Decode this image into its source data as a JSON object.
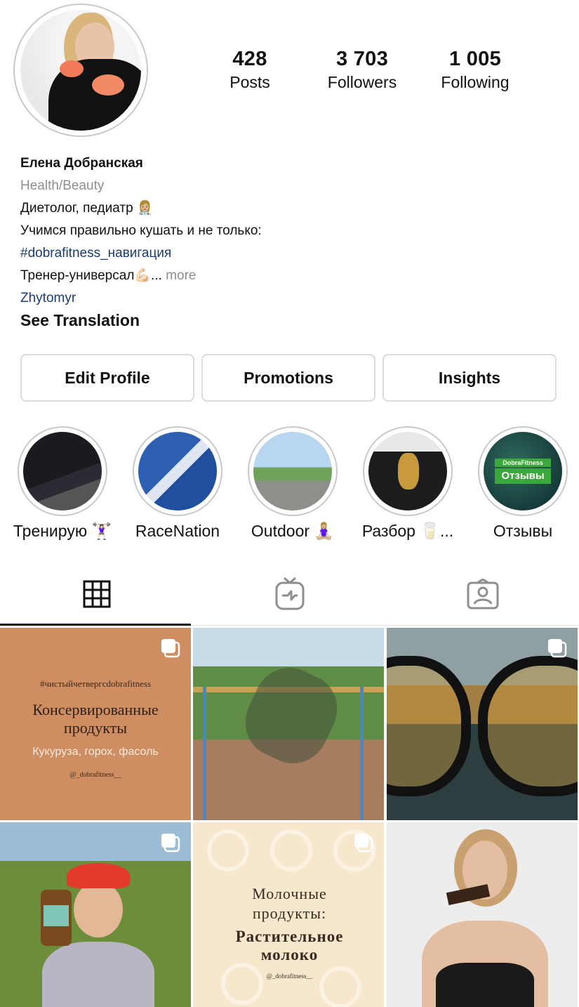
{
  "profile": {
    "stats": {
      "posts_count": "428",
      "posts_label": "Posts",
      "followers_count": "3 703",
      "followers_label": "Followers",
      "following_count": "1 005",
      "following_label": "Following"
    },
    "name": "Елена Добранская",
    "category": "Health/Beauty",
    "bio_line1": "Диетолог, педиатр 👩🏼‍⚕️",
    "bio_line2": "Учимся правильно кушать и не только:",
    "hashtag": "#dobrafitness_навигация",
    "bio_line4": "Тренер-универсал💪🏻...",
    "more_label": "more",
    "location": "Zhytomyr",
    "see_translation": "See Translation"
  },
  "actions": {
    "edit_profile": "Edit Profile",
    "promotions": "Promotions",
    "insights": "Insights"
  },
  "highlights": [
    {
      "label": "Тренирую 🏋🏻‍♀️"
    },
    {
      "label": "RaceNation"
    },
    {
      "label": "Outdoor 🧘🏼‍♀️"
    },
    {
      "label": "Разбор 🥛..."
    },
    {
      "label": "Отзывы",
      "badge_top": "DobraFitness",
      "badge_main": "Отзывы"
    }
  ],
  "tabs": [
    {
      "icon": "grid-icon",
      "active": true
    },
    {
      "icon": "igtv-icon",
      "active": false
    },
    {
      "icon": "tagged-icon",
      "active": false
    }
  ],
  "posts": {
    "tile1": {
      "hashtag": "#чистыйчетвергсdobrafitness",
      "title": "Консервированные продукты",
      "subtitle": "Кукуруза, горох, фасоль",
      "handle": "@_dobrafitness__",
      "multi": true
    },
    "tile2": {
      "multi": false
    },
    "tile3": {
      "multi": true
    },
    "tile4": {
      "multi": true
    },
    "tile5": {
      "title_line1": "Молочные",
      "title_line2": "продукты:",
      "title_line3": "Растительное",
      "title_line4": "молоко",
      "handle": "@_dobrafitness__",
      "multi": true
    },
    "tile6": {
      "multi": false
    }
  },
  "colors": {
    "link": "#1b3d6f",
    "secondary_text": "#8e8e8e",
    "border": "#dbdbdb"
  }
}
